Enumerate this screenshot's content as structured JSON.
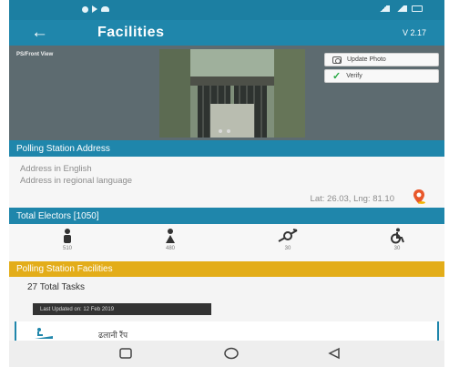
{
  "app_bar": {
    "title": "Facilities",
    "version": "V 2.17"
  },
  "photo": {
    "label": "PS/Front View",
    "update_label": "Update Photo",
    "verify_label": "Verify"
  },
  "address": {
    "header": "Polling Station Address",
    "english": "Address in English",
    "regional": "Address in regional language",
    "latlng": "Lat: 26.03, Lng: 81.10"
  },
  "electors": {
    "header": "Total Electors [1050]",
    "items": [
      {
        "name": "male",
        "count": "510"
      },
      {
        "name": "female",
        "count": "480"
      },
      {
        "name": "transgender",
        "count": "30"
      },
      {
        "name": "pwd",
        "count": "30"
      }
    ]
  },
  "facilities": {
    "header": "Polling Station Facilities",
    "total_tasks": "27 Total Tasks",
    "last_updated": "Last Updated on: 12 Feb 2019",
    "first_item": "ढलानी रैंप"
  },
  "colors": {
    "primary": "#1f86ab",
    "accent": "#e3ad19",
    "pin": "#e8572a"
  },
  "icons": {
    "back": "arrow-left-icon",
    "location": "map-pin-icon",
    "verify": "check-icon",
    "camera": "camera-icon"
  }
}
